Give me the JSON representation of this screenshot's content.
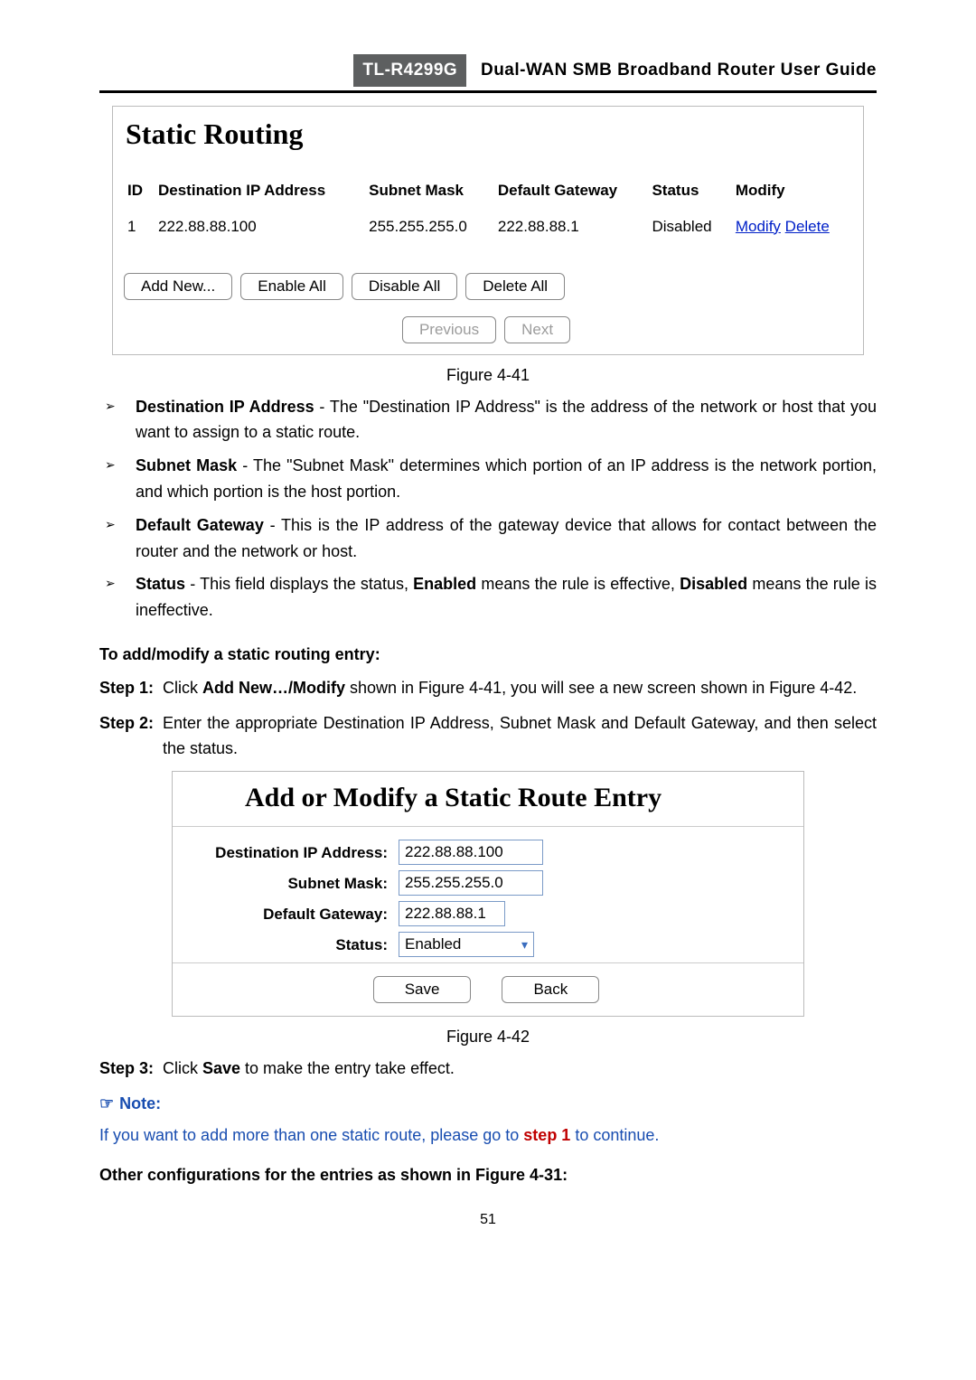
{
  "header": {
    "model": "TL-R4299G",
    "title": "Dual-WAN SMB Broadband Router User Guide"
  },
  "fig41": {
    "heading": "Static Routing",
    "caption": "Figure 4-41",
    "columns": [
      "ID",
      "Destination IP Address",
      "Subnet Mask",
      "Default Gateway",
      "Status",
      "Modify"
    ],
    "rows": [
      {
        "id": "1",
        "dest": "222.88.88.100",
        "mask": "255.255.255.0",
        "gw": "222.88.88.1",
        "status": "Disabled",
        "modify": "Modify",
        "delete": "Delete"
      }
    ],
    "buttons": {
      "add": "Add New...",
      "enable": "Enable All",
      "disable": "Disable All",
      "delete": "Delete All",
      "prev": "Previous",
      "next": "Next"
    }
  },
  "bullets": [
    {
      "term": "Destination IP Address",
      "text": " - The \"Destination IP Address\" is the address of the network or host that you want to assign to a static route."
    },
    {
      "term": "Subnet Mask",
      "text": " - The \"Subnet Mask\" determines which portion of an IP address is the network portion, and which portion is the host portion."
    },
    {
      "term": "Default Gateway",
      "text": " - This is the IP address of the gateway device that allows for contact between the router and the network or host."
    },
    {
      "term": "Status",
      "text_a": " - This field displays the status, ",
      "bold_a": "Enabled",
      "text_b": " means the rule is effective, ",
      "bold_b": "Disabled",
      "text_c": " means the rule is ineffective."
    }
  ],
  "toadd": "To add/modify a static routing entry:",
  "steps": {
    "s1": {
      "label": "Step 1:",
      "a": "Click ",
      "b": "Add New…/Modify",
      "c": " shown in Figure 4-41, you will see a new screen shown in Figure 4-42."
    },
    "s2": {
      "label": "Step 2:",
      "txt": "Enter the appropriate Destination IP Address, Subnet Mask and Default Gateway, and then select the status."
    },
    "s3": {
      "label": "Step 3:",
      "a": "Click ",
      "b": "Save",
      "c": " to make the entry take effect."
    }
  },
  "fig42": {
    "heading": "Add or Modify a Static Route Entry",
    "caption": "Figure 4-42",
    "labels": {
      "dest": "Destination IP Address:",
      "mask": "Subnet Mask:",
      "gw": "Default Gateway:",
      "status": "Status:"
    },
    "values": {
      "dest": "222.88.88.100",
      "mask": "255.255.255.0",
      "gw": "222.88.88.1",
      "status": "Enabled"
    },
    "buttons": {
      "save": "Save",
      "back": "Back"
    }
  },
  "note": {
    "label": "Note:",
    "text_a": "If you want to add more than one static route, please go to ",
    "step": "step 1",
    "text_b": " to continue."
  },
  "other": "Other configurations for the entries as shown in Figure 4-31:",
  "page_number": "51"
}
